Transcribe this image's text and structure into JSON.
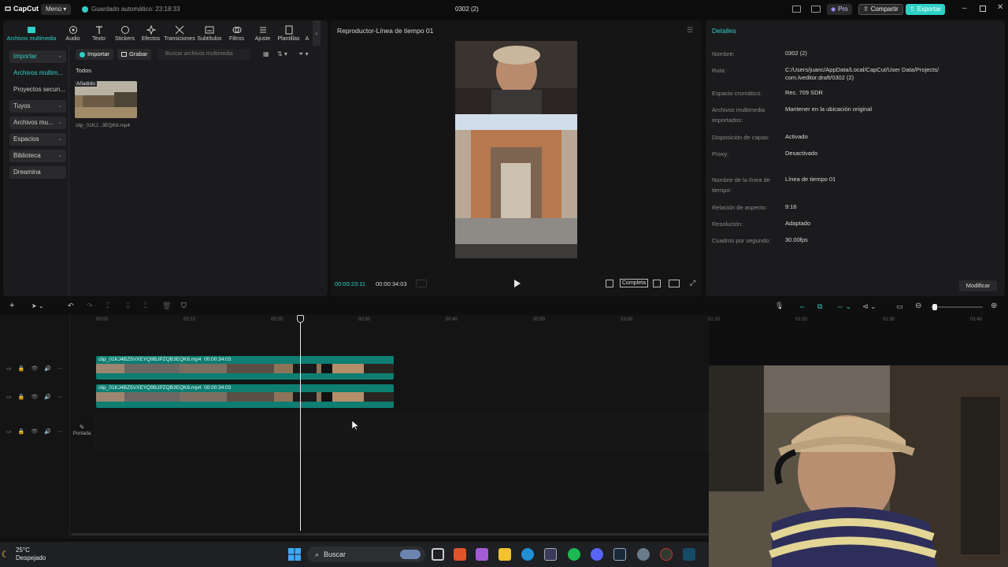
{
  "titlebar": {
    "app_name": "CapCut",
    "menu_label": "Menú",
    "autosave": "Guardado automático: 23:18:33",
    "window_title": "0302 (2)",
    "pro_label": "Pro",
    "share_label": "Compartir",
    "export_label": "Exportar"
  },
  "toolbar": {
    "items": [
      {
        "label": "Archivos multimedia",
        "icon": "media-icon",
        "active": true
      },
      {
        "label": "Audio",
        "icon": "audio-icon"
      },
      {
        "label": "Texto",
        "icon": "text-icon"
      },
      {
        "label": "Stickers",
        "icon": "sticker-icon"
      },
      {
        "label": "Efectos",
        "icon": "effects-icon"
      },
      {
        "label": "Transiciones",
        "icon": "transitions-icon"
      },
      {
        "label": "Subtítulos",
        "icon": "subtitles-icon"
      },
      {
        "label": "Filtros",
        "icon": "filters-icon"
      },
      {
        "label": "Ajuste",
        "icon": "adjust-icon"
      },
      {
        "label": "Plantillas",
        "icon": "templates-icon"
      },
      {
        "label": "A",
        "icon": "more-icon"
      }
    ]
  },
  "sidebar": {
    "items": [
      {
        "label": "Importar",
        "chevron": true
      },
      {
        "label": "Archivos multim..."
      },
      {
        "label": "Proyectos secun..."
      },
      {
        "label": "Tuyos",
        "chevron": true
      },
      {
        "label": "Archivos mu...",
        "chevron": true
      },
      {
        "label": "Espacios",
        "chevron": true
      },
      {
        "label": "Biblioteca",
        "chevron": true
      },
      {
        "label": "Dreamina"
      }
    ]
  },
  "media": {
    "import_label": "Importar",
    "record_label": "Grabar",
    "search_placeholder": "Buscar archivos multimedia",
    "filter_label": "Todos",
    "file_tag": "Añadido",
    "file_name": "clip_01KJ...3EQK8.mp4"
  },
  "player": {
    "title": "Reproductor-Línea de tiempo 01",
    "current_time": "00:00:23:11",
    "total_time": "00:00:34:03",
    "mode_label": "Completa"
  },
  "details": {
    "title": "Detalles",
    "rows": [
      {
        "key": "Nombre:",
        "value": "0302 (2)"
      },
      {
        "key": "Ruta:",
        "value": "C:/Users/juanc/AppData/Local/CapCut/User Data/Projects/ com.lveditor.draft/0302 (2)"
      },
      {
        "key": "Espacio cromático:",
        "value": "Rec. 709 SDR"
      },
      {
        "key": "Archivos multimedia importados:",
        "value": "Mantener en la ubicación original"
      },
      {
        "key": "Disposición de capas:",
        "value": "Activado"
      },
      {
        "key": "Proxy:",
        "value": "Desactivado"
      },
      {
        "key": "Nombre de la línea de tiempo:",
        "value": "Línea de tiempo 01"
      },
      {
        "key": "Relación de aspecto:",
        "value": "9:16"
      },
      {
        "key": "Resolución:",
        "value": "Adaptado"
      },
      {
        "key": "Cuadros por segundo:",
        "value": "30.00fps"
      }
    ],
    "modify_label": "Modificar"
  },
  "timeline": {
    "ruler": [
      "00:00",
      "00:10",
      "00:20",
      "00:30",
      "00:40",
      "00:50",
      "01:00",
      "01:10",
      "01:20",
      "01:30",
      "01:40"
    ],
    "clips": [
      {
        "name": "clip_01KJ4BZ5VXEYQ9BJPZQB3EQK8.mp4",
        "duration": "00:00:34:03"
      },
      {
        "name": "clip_01KJ4BZ5VXEYQ9BJPZQB3EQK8.mp4",
        "duration": "00:00:34:03"
      }
    ],
    "cover_label": "Portada"
  },
  "taskbar": {
    "temperature": "25°C",
    "weather": "Despejado",
    "search_label": "Buscar"
  },
  "colors": {
    "accent": "#2fd0c5",
    "clip": "#0e7d72",
    "bg": "#0f0f10"
  }
}
